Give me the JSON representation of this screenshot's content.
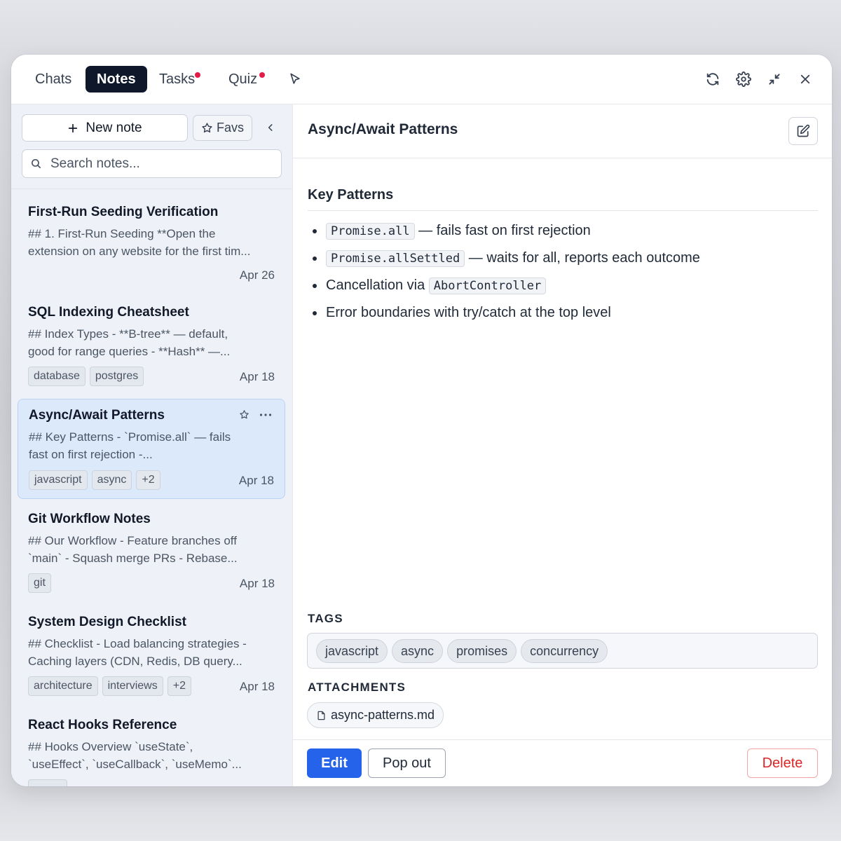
{
  "tabs": [
    {
      "label": "Chats",
      "active": false,
      "badge": false
    },
    {
      "label": "Notes",
      "active": true,
      "badge": false
    },
    {
      "label": "Tasks",
      "active": false,
      "badge": true
    },
    {
      "label": "Quiz",
      "active": false,
      "badge": true
    }
  ],
  "header_icons": [
    "cursor-icon",
    "refresh-icon",
    "gear-icon",
    "minimize-icon",
    "close-icon"
  ],
  "sidebar": {
    "new_note_label": "New note",
    "favs_label": "Favs",
    "search_placeholder": "Search notes...",
    "notes": [
      {
        "title": "First-Run Seeding Verification",
        "snippet": [
          "## 1. First-Run Seeding **Open the",
          "extension on any website for the first tim..."
        ],
        "date": "Apr 26",
        "tags": []
      },
      {
        "title": "SQL Indexing Cheatsheet",
        "snippet": [
          "## Index Types - **B-tree** — default,",
          "good for range queries - **Hash** —..."
        ],
        "date": "Apr 18",
        "tags": [
          "database",
          "postgres"
        ]
      },
      {
        "title": "Async/Await Patterns",
        "snippet": [
          "## Key Patterns - `Promise.all` — fails",
          "fast on first rejection -..."
        ],
        "date": "Apr 18",
        "tags": [
          "javascript",
          "async",
          "+2"
        ],
        "selected": true
      },
      {
        "title": "Git Workflow Notes",
        "snippet": [
          "## Our Workflow - Feature branches off",
          "`main` - Squash merge PRs - Rebase..."
        ],
        "date": "Apr 18",
        "tags": [
          "git"
        ]
      },
      {
        "title": "System Design Checklist",
        "snippet": [
          "## Checklist - Load balancing strategies -",
          "Caching layers (CDN, Redis, DB query..."
        ],
        "date": "Apr 18",
        "tags": [
          "architecture",
          "interviews",
          "+2"
        ]
      },
      {
        "title": "React Hooks Reference",
        "snippet": [
          "## Hooks Overview `useState`,",
          "`useEffect`, `useCallback`, `useMemo`..."
        ],
        "date": "",
        "tags": []
      }
    ]
  },
  "main": {
    "title": "Async/Await Patterns",
    "heading": "Key Patterns",
    "bullets": [
      {
        "code": "Promise.all",
        "text": " — fails fast on first rejection"
      },
      {
        "code": "Promise.allSettled",
        "text": " — waits for all, reports each outcome"
      },
      {
        "text_before": "Cancellation via ",
        "code": "AbortController"
      },
      {
        "text": "Error boundaries with try/catch at the top level"
      }
    ],
    "tags_label": "TAGS",
    "tags": [
      "javascript",
      "async",
      "promises",
      "concurrency"
    ],
    "attachments_label": "ATTACHMENTS",
    "attachment": "async-patterns.md",
    "edit_label": "Edit",
    "popout_label": "Pop out",
    "delete_label": "Delete"
  },
  "colors": {
    "accent": "#2563eb",
    "active_tab": "#0f172a",
    "badge": "#e11d48",
    "danger": "#dc2626",
    "selected_note": "#dbe9fb"
  }
}
